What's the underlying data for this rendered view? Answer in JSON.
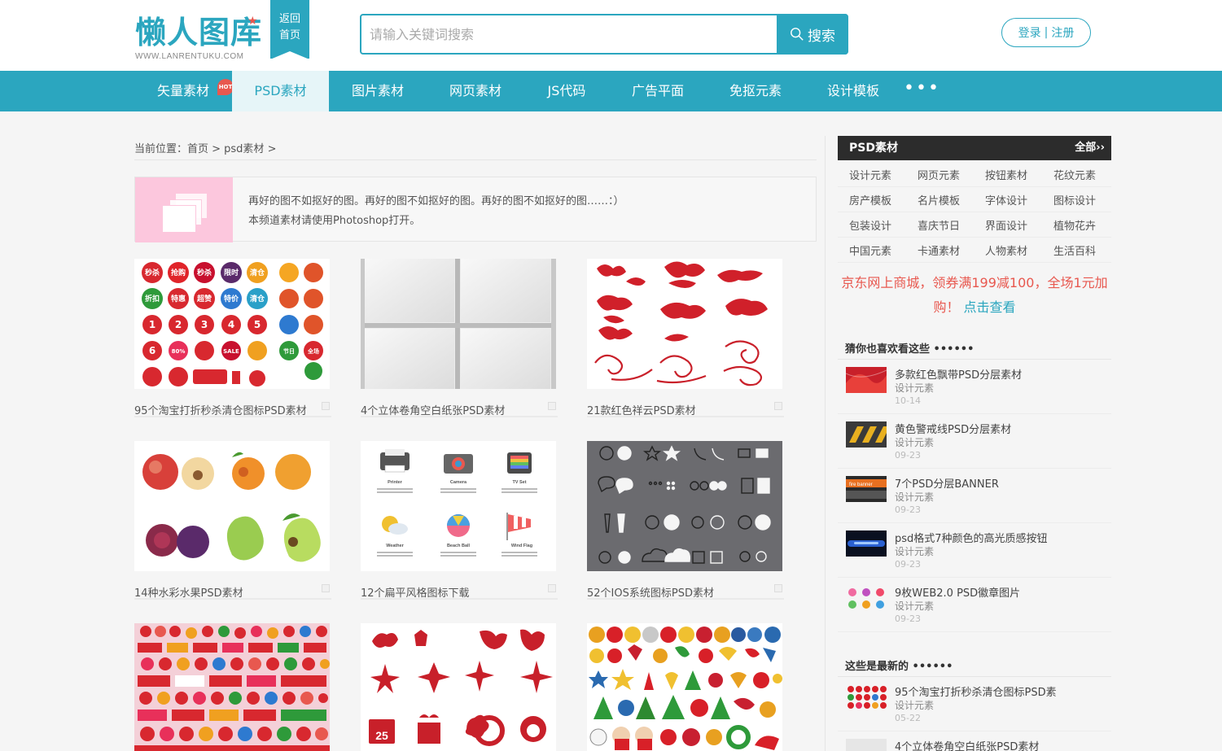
{
  "header": {
    "logo_text": "懒人图库",
    "logo_sub": "WWW.LANRENTUKU.COM",
    "back_line1": "返回",
    "back_line2": "首页",
    "search_placeholder": "请输入关键词搜索",
    "search_btn": "搜索",
    "login": "登录",
    "sep": "|",
    "register": "注册"
  },
  "nav": {
    "items": [
      "矢量素材",
      "PSD素材",
      "图片素材",
      "网页素材",
      "JS代码",
      "广告平面",
      "免抠元素",
      "设计模板"
    ],
    "hot": "HOT",
    "more": "•••"
  },
  "breadcrumb": "当前位置：首页 > psd素材 >",
  "info": {
    "line1": "再好的图不如抠好的图。再好的图不如抠好的图。再好的图不如抠好的图……：）",
    "line2": "本频道素材请使用Photoshop打开。"
  },
  "cards": [
    "95个淘宝打折秒杀清仓图标PSD素材",
    "4个立体卷角空白纸张PSD素材",
    "21款红色祥云PSD素材",
    "14种水彩水果PSD素材",
    "12个扁平风格图标下载",
    "52个IOS系统图标PSD素材",
    "",
    "",
    ""
  ],
  "card_art": {
    "c1_labels": [
      "秒杀",
      "抢购",
      "秒杀",
      "限时",
      "清仓",
      "折扣",
      "特惠",
      "超赞",
      "特价",
      "清仓"
    ],
    "c1_nums": [
      "1",
      "2",
      "3",
      "4",
      "5",
      "6",
      "80%",
      "SALE",
      "节日",
      "全场"
    ],
    "c5_labels": [
      "Printer",
      "Camera",
      "TV Set",
      "Weather",
      "Beach Ball",
      "Wind Flag"
    ],
    "c8_date": "25"
  },
  "sidebar": {
    "head_title": "PSD素材",
    "head_all": "全部››",
    "tags": [
      "设计元素",
      "网页元素",
      "按钮素材",
      "花纹元素",
      "房产模板",
      "名片模板",
      "字体设计",
      "图标设计",
      "包装设计",
      "喜庆节日",
      "界面设计",
      "植物花卉",
      "中国元素",
      "卡通素材",
      "人物素材",
      "生活百科"
    ],
    "promo_text": "京东网上商城，领券满199减100，全场1元加购！",
    "promo_link": "点击查看",
    "guess_title": "猜你也喜欢看这些 ••••••",
    "guess": [
      {
        "title": "多款红色飘带PSD分层素材",
        "cat": "设计元素",
        "date": "10-14"
      },
      {
        "title": "黄色警戒线PSD分层素材",
        "cat": "设计元素",
        "date": "09-23"
      },
      {
        "title": "7个PSD分层BANNER",
        "cat": "设计元素",
        "date": "09-23"
      },
      {
        "title": "psd格式7种颜色的高光质感按钮",
        "cat": "设计元素",
        "date": "09-23"
      },
      {
        "title": "9枚WEB2.0 PSD徽章图片",
        "cat": "设计元素",
        "date": "09-23"
      }
    ],
    "banner_text": "fire banner",
    "latest_title": "这些是最新的 ••••••",
    "latest": [
      {
        "title": "95个淘宝打折秒杀清仓图标PSD素",
        "cat": "设计元素",
        "date": "05-22"
      },
      {
        "title": "4个立体卷角空白纸张PSD素材",
        "cat": "",
        "date": ""
      }
    ]
  },
  "colors": {
    "brand": "#2ba6bf",
    "accent_red": "#e8584f"
  }
}
